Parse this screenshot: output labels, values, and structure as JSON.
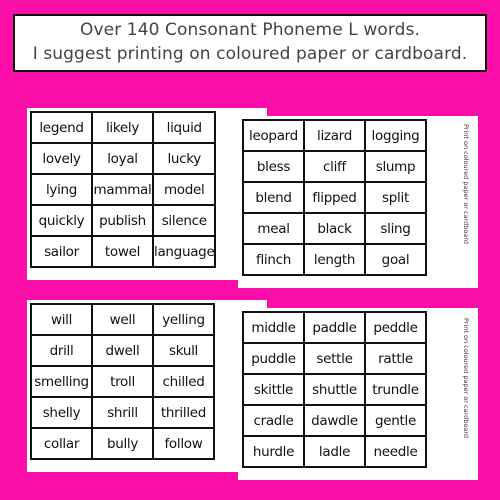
{
  "header": {
    "line1": "Over 140 Consonant Phoneme L words.",
    "line2": "I suggest printing on coloured paper or cardboard."
  },
  "colors": {
    "background": "#fb0fa8",
    "card": "#ffffff",
    "border": "#111111"
  },
  "cards": [
    {
      "rows": [
        [
          "legend",
          "likely",
          "liquid"
        ],
        [
          "lovely",
          "loyal",
          "lucky"
        ],
        [
          "lying",
          "mammal",
          "model"
        ],
        [
          "quickly",
          "publish",
          "silence"
        ],
        [
          "sailor",
          "towel",
          "language"
        ]
      ]
    },
    {
      "side_note": "Print on coloured paper or cardboard",
      "rows": [
        [
          "leopard",
          "lizard",
          "logging"
        ],
        [
          "bless",
          "cliff",
          "slump"
        ],
        [
          "blend",
          "flipped",
          "split"
        ],
        [
          "meal",
          "black",
          "sling"
        ],
        [
          "flinch",
          "length",
          "goal"
        ]
      ]
    },
    {
      "rows": [
        [
          "will",
          "well",
          "yelling"
        ],
        [
          "drill",
          "dwell",
          "skull"
        ],
        [
          "smelling",
          "troll",
          "chilled"
        ],
        [
          "shelly",
          "shrill",
          "thrilled"
        ],
        [
          "collar",
          "bully",
          "follow"
        ]
      ]
    },
    {
      "side_note": "Print on coloured paper or cardboard",
      "rows": [
        [
          "middle",
          "paddle",
          "peddle"
        ],
        [
          "puddle",
          "settle",
          "rattle"
        ],
        [
          "skittle",
          "shuttle",
          "trundle"
        ],
        [
          "cradle",
          "dawdle",
          "gentle"
        ],
        [
          "hurdle",
          "ladle",
          "needle"
        ]
      ]
    }
  ]
}
